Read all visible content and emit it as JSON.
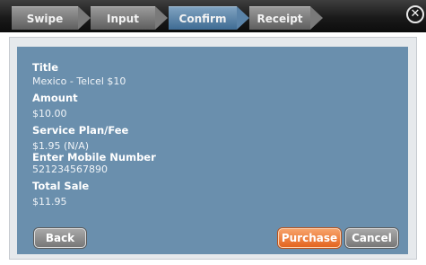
{
  "steps": [
    {
      "label": "Swipe"
    },
    {
      "label": "Input"
    },
    {
      "label": "Confirm"
    },
    {
      "label": "Receipt"
    }
  ],
  "active_step": "Confirm",
  "close_glyph": "✕",
  "fields": {
    "title_label": "Title",
    "title_value": "Mexico - Telcel $10",
    "amount_label": "Amount",
    "amount_value": "$10.00",
    "plan_label": "Service Plan/Fee",
    "plan_value": "$1.95 (N/A)",
    "mobile_label": "Enter Mobile Number",
    "mobile_value": "521234567890",
    "total_label": "Total Sale",
    "total_value": "$11.95"
  },
  "buttons": {
    "back": "Back",
    "purchase": "Purchase",
    "cancel": "Cancel"
  },
  "colors": {
    "panel": "#6a8fad",
    "active_step": "#5a83a8",
    "purchase": "#ec7834"
  },
  "icons": [
    "close-icon",
    "step-arrow-icon"
  ]
}
